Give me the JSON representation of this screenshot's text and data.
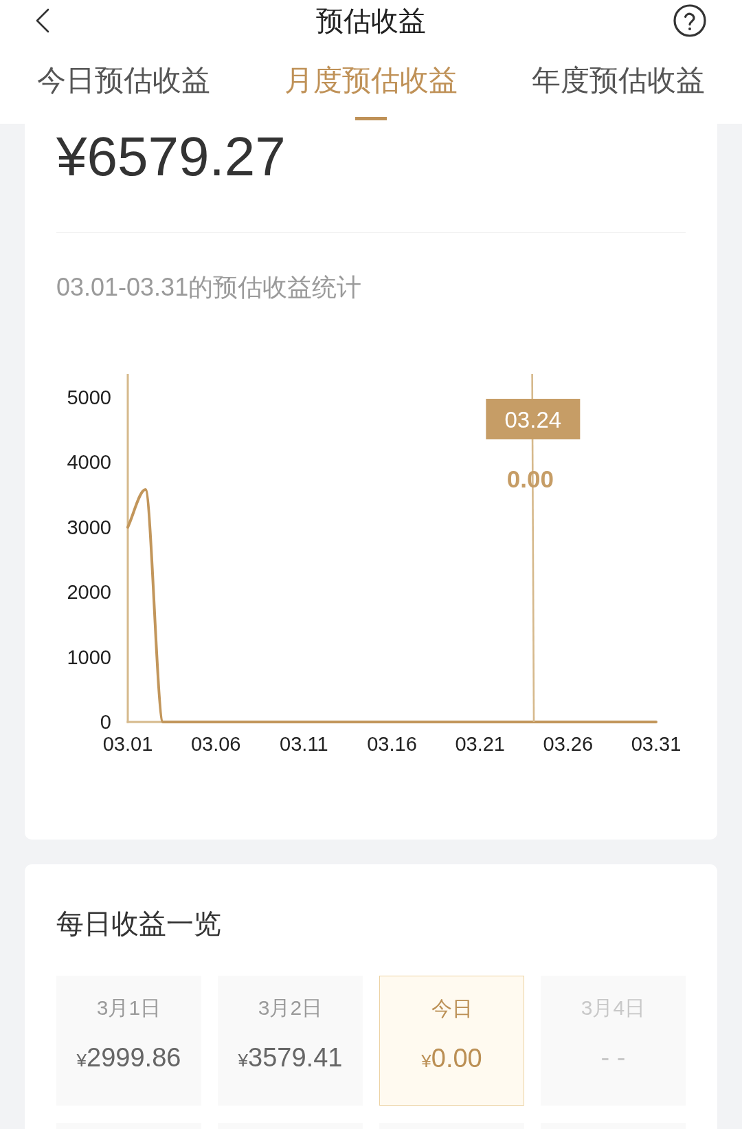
{
  "header": {
    "title": "预估收益"
  },
  "tabs": [
    {
      "label": "今日预估收益",
      "selected": false
    },
    {
      "label": "月度预估收益",
      "selected": true
    },
    {
      "label": "年度预估收益",
      "selected": false
    }
  ],
  "summary": {
    "amount": "¥6579.27",
    "subtitle": "03.01-03.31的预估收益统计",
    "chart_data": {
      "type": "line",
      "categories": [
        "03.01",
        null,
        null,
        null,
        null,
        "03.06",
        null,
        null,
        null,
        null,
        "03.11",
        null,
        null,
        null,
        null,
        "03.16",
        null,
        null,
        null,
        null,
        "03.21",
        null,
        null,
        null,
        null,
        "03.26",
        null,
        null,
        null,
        null,
        "03.31"
      ],
      "ylim": [
        0,
        5360
      ],
      "yticks": [
        0,
        1000,
        2000,
        3000,
        4000,
        5000
      ],
      "series": [
        {
          "color": "#c2965b",
          "values": [
            3000,
            3580,
            0,
            0,
            0,
            0,
            0,
            0,
            0,
            0,
            0,
            0,
            0,
            0,
            0,
            0,
            0,
            0,
            0,
            0,
            0,
            0,
            0,
            0,
            0,
            0,
            0,
            0,
            0,
            0,
            0
          ]
        }
      ],
      "annotations": [
        "03.24",
        "0.00"
      ]
    },
    "scrubber": {
      "level": 0.767
    }
  },
  "daily": {
    "title": "每日收益一览",
    "days": [
      {
        "date": "3月1日",
        "currency": "¥",
        "amount": "2999.86",
        "kind": "past"
      },
      {
        "date": "3月2日",
        "currency": "¥",
        "amount": "3579.41",
        "kind": "past"
      },
      {
        "date": "今日",
        "currency": "¥",
        "amount": "0.00",
        "kind": "today"
      },
      {
        "date": "3月4日",
        "amount": "- -",
        "kind": "future"
      },
      {
        "kind": "future"
      },
      {
        "kind": "future"
      },
      {
        "kind": "future"
      },
      {
        "kind": "future"
      }
    ]
  }
}
